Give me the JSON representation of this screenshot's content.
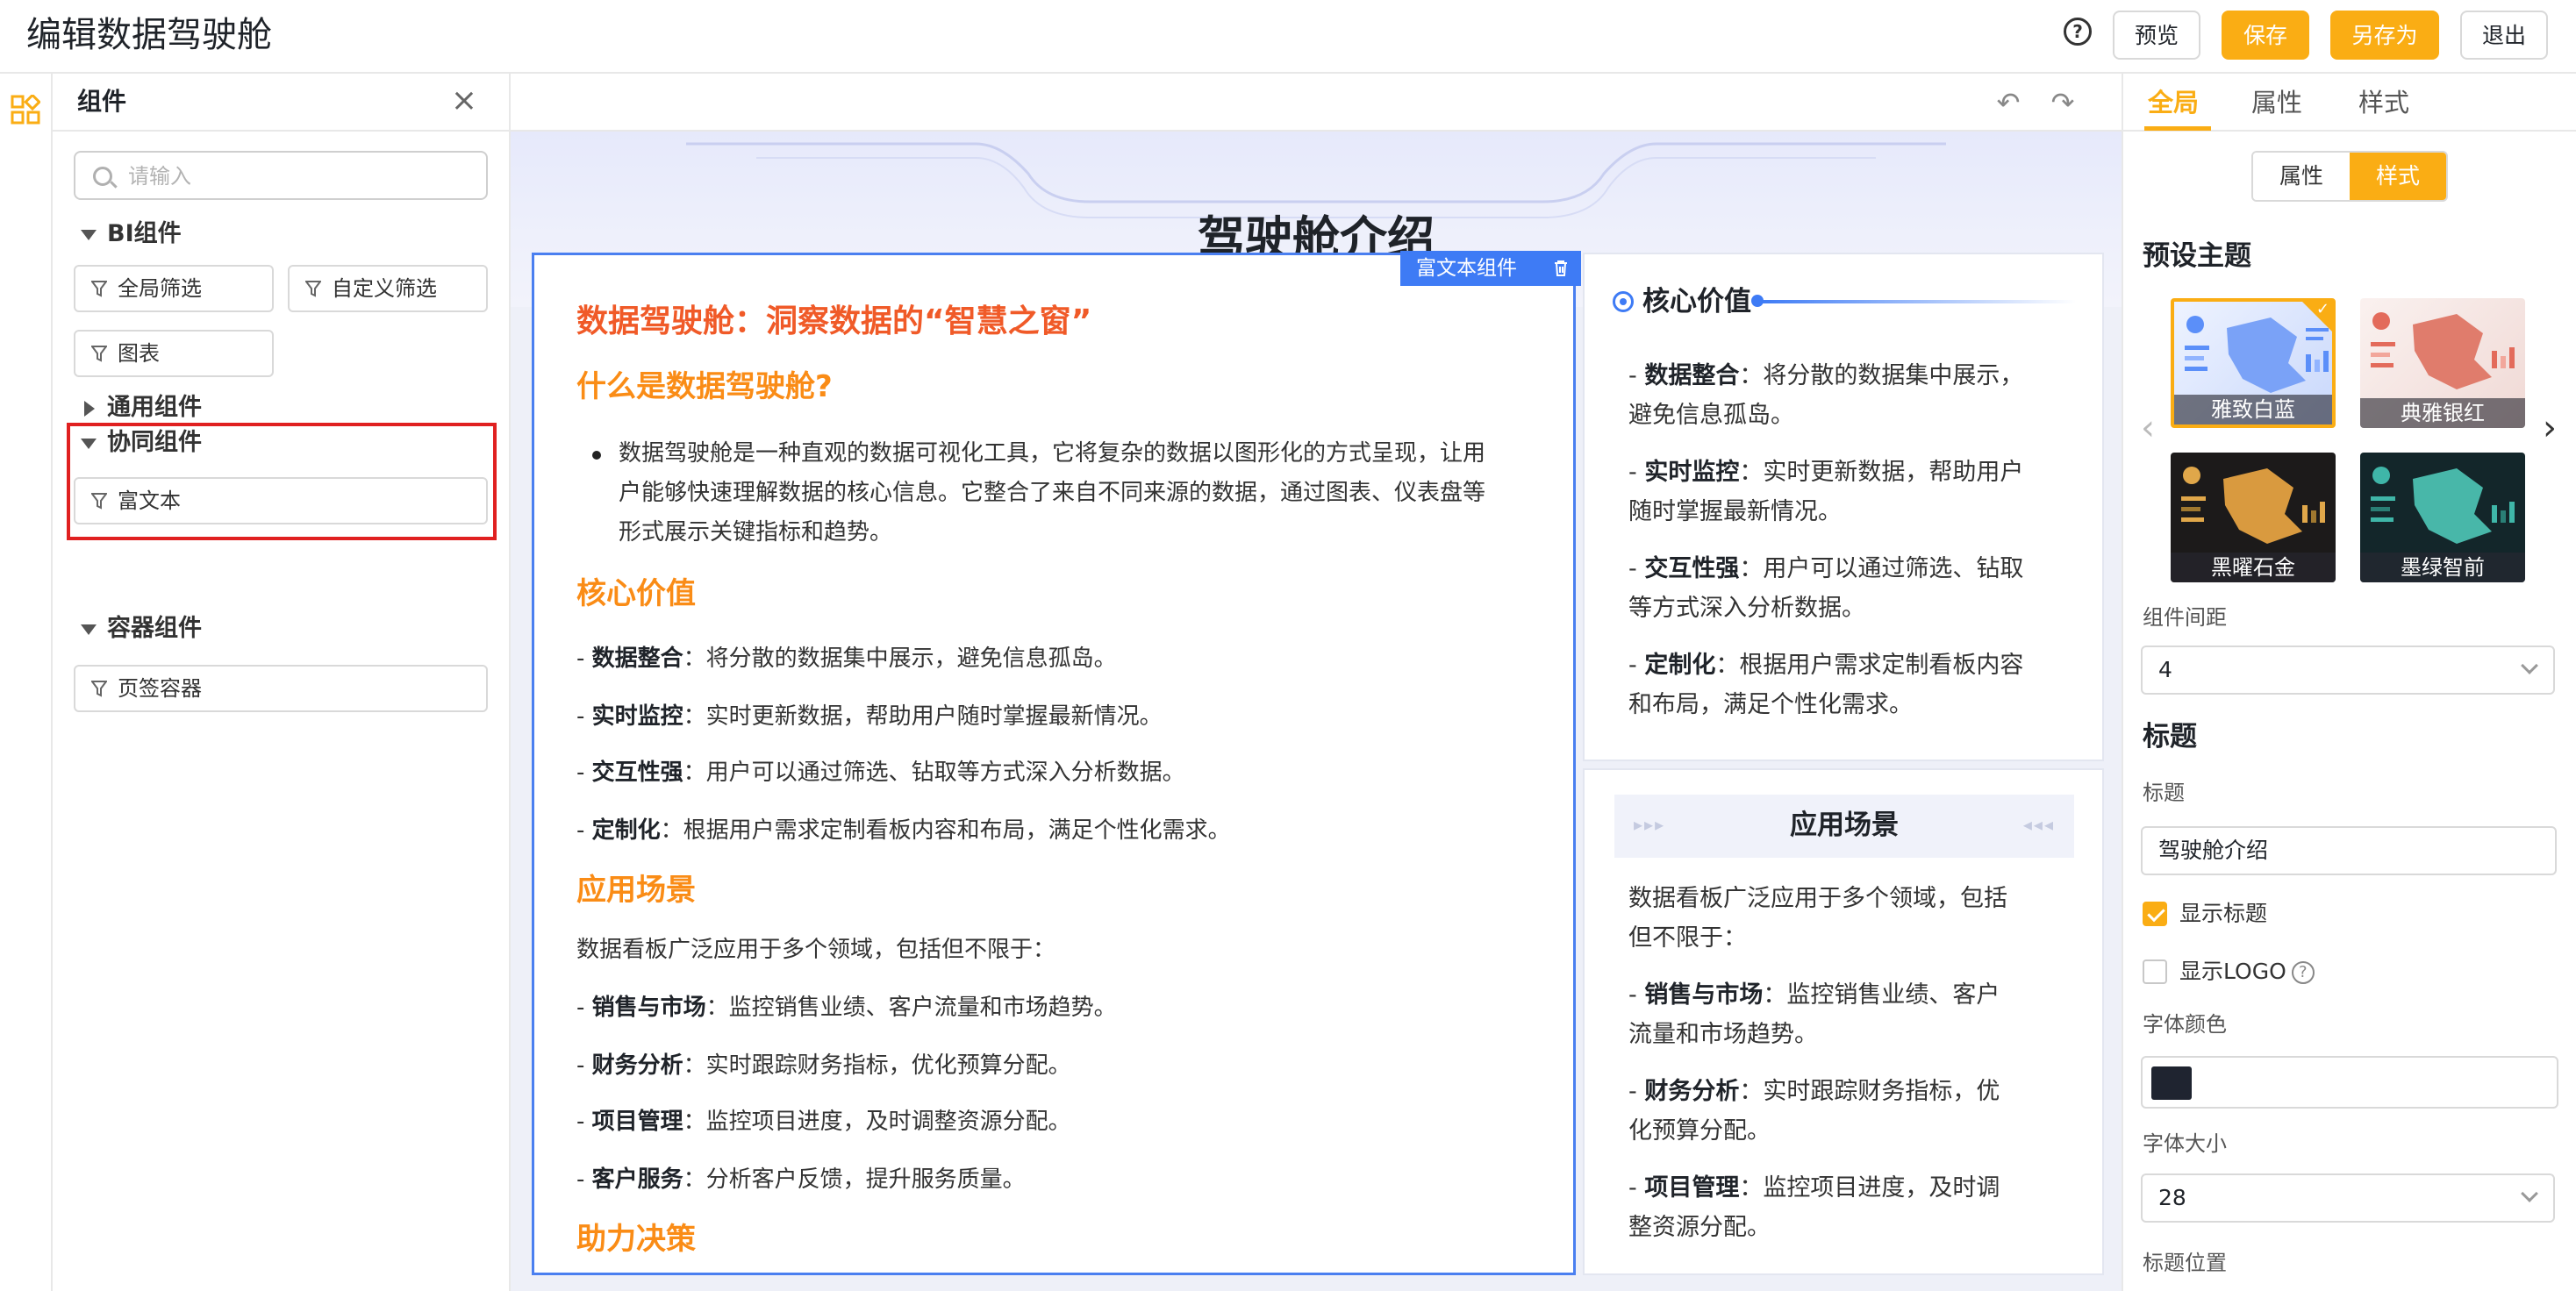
{
  "app": {
    "title": "编辑数据驾驶舱"
  },
  "topbar": {
    "preview": "预览",
    "save": "保存",
    "save_as": "另存为",
    "exit": "退出"
  },
  "components_panel": {
    "title": "组件",
    "search_placeholder": "请输入",
    "groups": {
      "bi": {
        "label": "BI组件",
        "items": [
          "全局筛选",
          "自定义筛选",
          "图表"
        ]
      },
      "common": {
        "label": "通用组件"
      },
      "collab": {
        "label": "协同组件",
        "items": [
          "富文本"
        ]
      },
      "container": {
        "label": "容器组件",
        "items": [
          "页签容器"
        ]
      }
    }
  },
  "canvas": {
    "dashboard_title": "驾驶舱介绍",
    "rich_text": {
      "tag": "富文本组件",
      "h1": "数据驾驶舱：洞察数据的“智慧之窗”",
      "what_heading": "什么是数据驾驶舱?",
      "what_body": "数据驾驶舱是一种直观的数据可视化工具，它将复杂的数据以图形化的方式呈现，让用户能够快速理解数据的核心信息。它整合了来自不同来源的数据，通过图表、仪表盘等形式展示关键指标和趋势。",
      "core_heading": "核心价值",
      "core_items": [
        {
          "key": "数据整合",
          "text": "：将分散的数据集中展示，避免信息孤岛。"
        },
        {
          "key": "实时监控",
          "text": "：实时更新数据，帮助用户随时掌握最新情况。"
        },
        {
          "key": "交互性强",
          "text": "：用户可以通过筛选、钻取等方式深入分析数据。"
        },
        {
          "key": "定制化",
          "text": "：根据用户需求定制看板内容和布局，满足个性化需求。"
        }
      ],
      "scene_heading": "应用场景",
      "scene_intro": "数据看板广泛应用于多个领域，包括但不限于：",
      "scene_items": [
        {
          "key": "销售与市场",
          "text": "：监控销售业绩、客户流量和市场趋势。"
        },
        {
          "key": "财务分析",
          "text": "：实时跟踪财务指标，优化预算分配。"
        },
        {
          "key": "项目管理",
          "text": "：监控项目进度，及时调整资源分配。"
        },
        {
          "key": "客户服务",
          "text": "：分析客户反馈，提升服务质量。"
        }
      ],
      "decision_heading": "助力决策"
    },
    "core_card": {
      "title": "核心价值",
      "items": [
        {
          "key": "数据整合",
          "line1": "：将分散的数据集中展示，",
          "line2": "避免信息孤岛。"
        },
        {
          "key": "实时监控",
          "line1": "：实时更新数据，帮助用户",
          "line2": "随时掌握最新情况。"
        },
        {
          "key": "交互性强",
          "line1": "：用户可以通过筛选、钻取",
          "line2": "等方式深入分析数据。"
        },
        {
          "key": "定制化",
          "line1": "：根据用户需求定制看板内容",
          "line2": "和布局，满足个性化需求。"
        }
      ]
    },
    "scene_card": {
      "title": "应用场景",
      "intro_line1": "数据看板广泛应用于多个领域，包括",
      "intro_line2": "但不限于：",
      "items": [
        {
          "key": "销售与市场",
          "line1": "：监控销售业绩、客户",
          "line2": "流量和市场趋势。"
        },
        {
          "key": "财务分析",
          "line1": "：实时跟踪财务指标，优",
          "line2": "化预算分配。"
        },
        {
          "key": "项目管理",
          "line1": "：监控项目进度，及时调",
          "line2": "整资源分配。"
        }
      ]
    }
  },
  "props_panel": {
    "tabs": [
      "全局",
      "属性",
      "样式"
    ],
    "segment": [
      "属性",
      "样式"
    ],
    "preset_theme_label": "预设主题",
    "themes": [
      {
        "name": "雅致白蓝",
        "selected": true
      },
      {
        "name": "典雅银红",
        "selected": false
      },
      {
        "name": "黑曜石金",
        "selected": false
      },
      {
        "name": "墨绿智前",
        "selected": false
      }
    ],
    "spacing_label": "组件间距",
    "spacing_value": "4",
    "title_section": "标题",
    "title_label": "标题",
    "title_value": "驾驶舱介绍",
    "show_title": "显示标题",
    "show_logo": "显示LOGO",
    "font_color_label": "字体颜色",
    "font_color": "#1f2430",
    "font_size_label": "字体大小",
    "font_size_value": "28",
    "title_position_label": "标题位置"
  },
  "colors": {
    "accent": "#faad14",
    "primary": "#3e7bf5",
    "heading_red": "#f05a28",
    "heading_orange": "#fa8c16"
  }
}
